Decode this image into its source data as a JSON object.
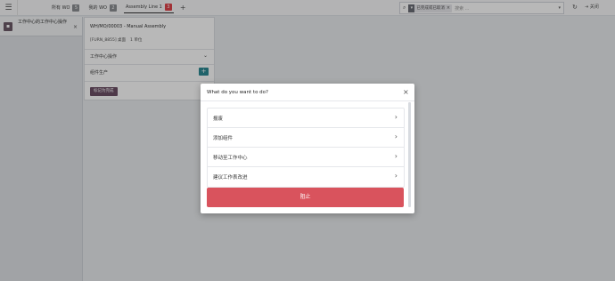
{
  "topbar": {
    "menu_icon": "hamburger-menu-icon",
    "tabs": [
      {
        "label": "所有 WO",
        "count": "5",
        "active": false
      },
      {
        "label": "我的 WO",
        "count": "2",
        "active": false
      },
      {
        "label": "Assembly Line 1",
        "count": "3",
        "active": true
      }
    ],
    "add_tab": "+",
    "search": {
      "facet_label": "已完成或已取消",
      "placeholder": "搜索 ..."
    },
    "refresh_icon": "↻",
    "close_label": "关闭"
  },
  "left_panel": {
    "workorder": {
      "name": "工作中心的工作中心操作"
    }
  },
  "work_order": {
    "title": "WH/MO/00003 - Manual Assembly",
    "product": "[FURN_8855] 桌面",
    "qty": "1 单位",
    "row1_label": "工作中心操作",
    "row2_label": "组件生产",
    "done_button": "标记为完成"
  },
  "modal": {
    "title": "What do you want to do?",
    "options": [
      {
        "label": "报废"
      },
      {
        "label": "添加组件"
      },
      {
        "label": "移动至工作中心"
      },
      {
        "label": "建议工作表改进"
      }
    ],
    "stop_button": "阻止"
  }
}
